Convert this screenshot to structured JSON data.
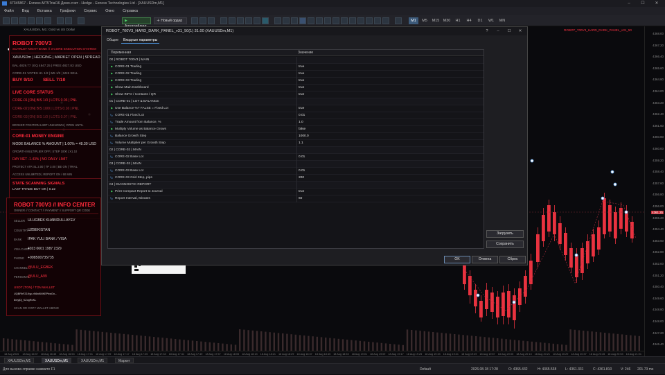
{
  "window": {
    "title": "47345867 - Exness-MT5Trial16 Демо-счет - Hedge - Exness Technologies Ltd - [XAUUSDm,M1]"
  },
  "menu": [
    "Файл",
    "Вид",
    "Вставка",
    "Графики",
    "Сервис",
    "Окно",
    "Справка"
  ],
  "toolbar": {
    "algo_label": "Алготрейдинг",
    "new_order_label": "Новый ордер"
  },
  "timeframes": [
    "M1",
    "M5",
    "M15",
    "M30",
    "H1",
    "H4",
    "D1",
    "W1",
    "MN"
  ],
  "timeframe_active": "M1",
  "chart": {
    "symbol_label": "XAUUSDm, M1: Gold vs US Dollar",
    "indicator_label": "ROBOT_700V3_HARD_DARK_PANEL_v31_50",
    "prices": [
      "4368.00",
      "4367.20",
      "4366.40",
      "4365.60",
      "4364.80",
      "4364.00",
      "4363.20",
      "4362.40",
      "4361.60",
      "4360.80",
      "4360.00",
      "4359.20",
      "4358.40",
      "4357.60",
      "4356.80",
      "4356.00",
      "4355.20",
      "4354.40",
      "4353.60",
      "4352.80",
      "4352.00",
      "4351.20",
      "4350.40",
      "4349.60",
      "4348.80",
      "4348.00",
      "4347.20",
      "4346.40"
    ],
    "current_price": "4361.25",
    "times": [
      "18 Aug 2026",
      "18 Aug 16:37",
      "18 Aug 16:45",
      "18 Aug 16:53",
      "18 Aug 17:01",
      "18 Aug 17:09",
      "18 Aug 17:17",
      "18 Aug 17:25",
      "18 Aug 17:33",
      "18 Aug 17:41",
      "18 Aug 17:49",
      "18 Aug 17:57",
      "18 Aug 18:05",
      "18 Aug 18:13",
      "18 Aug 18:21",
      "18 Aug 18:29",
      "18 Aug 18:37",
      "18 Aug 18:45",
      "18 Aug 18:53",
      "18 Aug 19:01",
      "18 Aug 19:09",
      "18 Aug 19:17",
      "18 Aug 19:25",
      "18 Aug 19:33",
      "18 Aug 19:41",
      "18 Aug 19:49",
      "18 Aug 19:57",
      "18 Aug 20:05",
      "18 Aug 20:13",
      "18 Aug 20:21",
      "18 Aug 20:29",
      "18 Aug 20:37",
      "18 Aug 20:45",
      "18 Aug 20:53",
      "18 Aug 21:01"
    ]
  },
  "panel": {
    "title": "ROBOT 700V3",
    "subtitle": "SCARLET NIGHT BANK // 3 CORE EXECUTION SYSTEM",
    "line1": "XAUUSDm | HEDGING | MARKET OPEN | SPREAD",
    "line2": "BAL 4829.77 | EQ 4847.25 | FREE 4827.83 USD",
    "line3": "CORE-01 VOTES  H1 1/2  | M5 1/2  | M15 SELL",
    "buy": "BUY 9/10",
    "sell": "SELL 7/10",
    "live_title": "LIVE CORE STATUS",
    "core1": "CORE-01 [ON]  B/S 1/0 | LOTS 0.03 | PNL",
    "core2": "CORE-02 [ON]  B/S 10/0 | LOTS 0.16 | PNL",
    "core3": "CORE-03 [ON]  B/S 1/0 | LOTS 0.07 | PNL",
    "broker": "BROKER POSITION LIMIT UNKNOWN | OPEN UNTIL",
    "money_title": "CORE-01 MONEY ENGINE",
    "mode": "MODE BALANCE % AMOUNT | 1.00% = 48.30 USD",
    "growth": "GROWTH MULTIPLIER OFF | STEP 1000 | X1.10",
    "daynet": "DAY NET -1.43% | NO DAILY LIMIT",
    "protect": "PROTECT ATR SL 2.00 | TP 3.00 | BE ON | TRAIL",
    "access": "ACCESS UNLIMITED | REPORT ON / 60 MIN",
    "scan_title": "STATE SCANNING SIGNALS",
    "last": "LAST TRADE BUY OK | 0.22"
  },
  "info": {
    "title": "ROBOT 700V3 // INFO CENTER",
    "subtitle": "OWNER // CONTACT // PAYMENT // SUPPORT QR CODE",
    "rows": [
      {
        "k": "SELLER",
        "v": "ULUGBEK KHABIDULLAYEV"
      },
      {
        "k": "COUNTRY",
        "v": "UZBEKISTAN"
      },
      {
        "k": "BANK",
        "v": "IPAK YULI BANK / VISA"
      },
      {
        "k": "VISA CARD",
        "v": "4023 0601 1987 2329"
      },
      {
        "k": "PHONE",
        "v": "+998500735735"
      },
      {
        "k": "CHANNEL",
        "v": "@ULU_EGBEK"
      },
      {
        "k": "PERSONAL",
        "v": "@ULU_A99"
      }
    ],
    "usdt_title": "USDT (TON) / TON WALLET",
    "wallet1": "UQBRhFZ1Kyp-rN6nKMKEPhwGn--",
    "wallet2": "8xryjDj_KZogRoKL",
    "scan_note": "SCAN OR COPY WALLET ABOVE"
  },
  "dialog": {
    "title": "ROBOT_700V3_HARD_DARK_PANEL_v31_50(1) 31.00 (XAUUSDm,M1)",
    "tabs": [
      "Общие",
      "Входные параметры"
    ],
    "active_tab": "Входные параметры",
    "col_name": "Переменная",
    "col_value": "Значение",
    "rows": [
      {
        "n": "00 | ROBOT 700V3 | MAIN",
        "v": "",
        "t": "sec"
      },
      {
        "n": "CORE-01 Trading",
        "v": "true",
        "t": "b"
      },
      {
        "n": "CORE-02 Trading",
        "v": "true",
        "t": "b"
      },
      {
        "n": "CORE-03 Trading",
        "v": "true",
        "t": "b"
      },
      {
        "n": "Show Main Dashboard",
        "v": "true",
        "t": "b"
      },
      {
        "n": "Show INFO / Contacts / QR",
        "v": "true",
        "t": "b"
      },
      {
        "n": "01 | CORE-01 | LOT & BALANCE",
        "v": "",
        "t": "sec"
      },
      {
        "n": "Use Balance %? FALSE = Fixed Lot",
        "v": "true",
        "t": "b"
      },
      {
        "n": "CORE-01 Fixed Lot",
        "v": "0.01",
        "t": "d"
      },
      {
        "n": "Trade Amount from Balance, %",
        "v": "1.0",
        "t": "d"
      },
      {
        "n": "Multiply Volume as Balance Grows",
        "v": "false",
        "t": "b"
      },
      {
        "n": "Balance Growth Step",
        "v": "1000.0",
        "t": "d"
      },
      {
        "n": "Volume Multiplier per Growth Step",
        "v": "1.1",
        "t": "d"
      },
      {
        "n": "02 | CORE-02 | MAIN",
        "v": "",
        "t": "sec"
      },
      {
        "n": "CORE-02 Base Lot",
        "v": "0.01",
        "t": "d"
      },
      {
        "n": "03 | CORE-03 | MAIN",
        "v": "",
        "t": "sec"
      },
      {
        "n": "CORE-03 Base Lot",
        "v": "0.01",
        "t": "d"
      },
      {
        "n": "CORE-03 Grid Step, pips",
        "v": "200",
        "t": "d"
      },
      {
        "n": "04 | DIAGNOSTIC REPORT",
        "v": "",
        "t": "sec"
      },
      {
        "n": "Print Compact Report to Journal",
        "v": "true",
        "t": "b"
      },
      {
        "n": "Report Interval, Minutes",
        "v": "60",
        "t": "d"
      }
    ],
    "load_label": "Загрузить",
    "save_label": "Сохранить",
    "ok_label": "OK",
    "cancel_label": "Отмена",
    "reset_label": "Сброс"
  },
  "chart_tabs": [
    "XAUUSDm,M1",
    "XAUUSDm,M1",
    "XAUUSDm,M1",
    "Маркет"
  ],
  "status": {
    "help": "Для вызова справки нажмите F1",
    "profile": "Default",
    "datetime": "2026.08.18 17:28",
    "open": "O: 4365.432",
    "high": "H: 4365.538",
    "low": "L: 4361.331",
    "close": "C: 4361.810",
    "volume": "V: 246",
    "traffic": "201.73 ms"
  }
}
